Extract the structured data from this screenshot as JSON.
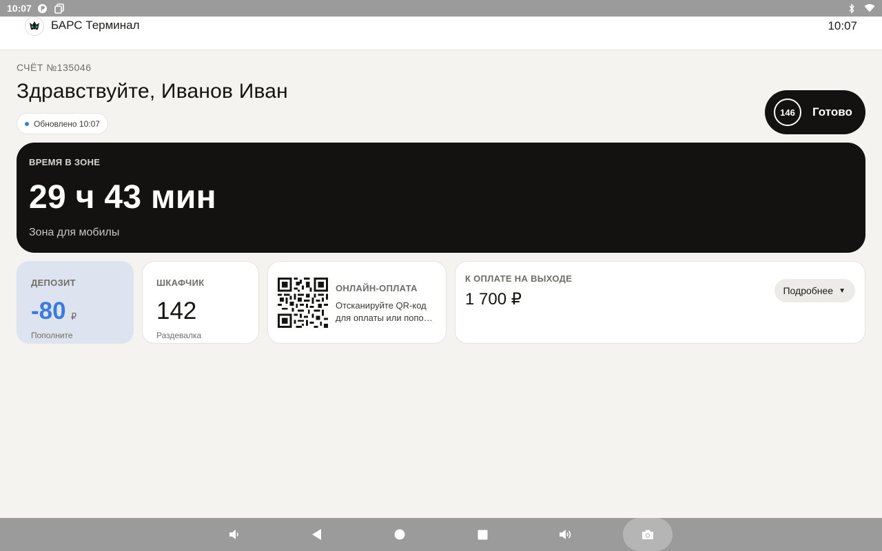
{
  "status_bar": {
    "time": "10:07"
  },
  "header": {
    "app_title": "БАРС Терминал",
    "clock": "10:07"
  },
  "account": {
    "label": "СЧЁТ №135046"
  },
  "greeting": "Здравствуйте, Иванов Иван",
  "updated": {
    "text": "Обновлено 10:07",
    "dot_color": "#3b7be0"
  },
  "ready_button": {
    "number": "146",
    "label": "Готово"
  },
  "zone": {
    "label": "ВРЕМЯ В ЗОНЕ",
    "time": "29 ч 43 мин",
    "name": "Зона для мобилы"
  },
  "deposit": {
    "label": "ДЕПОЗИТ",
    "amount": "-80",
    "currency": "₽",
    "hint": "Пополните",
    "amount_color": "#3b7be0"
  },
  "locker": {
    "label": "ШКАФЧИК",
    "number": "142",
    "location": "Раздевалка"
  },
  "online_payment": {
    "label": "ОНЛАЙН-ОПЛАТА",
    "line1": "Отсканируйте QR-код",
    "line2": "для оплаты или попо…"
  },
  "exit_payment": {
    "label": "К ОПЛАТЕ НА ВЫХОДЕ",
    "amount": "1 700 ₽",
    "details_label": "Подробнее"
  },
  "nav_bar": {
    "buttons": [
      "volume-down-icon",
      "back-icon",
      "home-icon",
      "recents-icon",
      "volume-up-icon",
      "camera-icon"
    ]
  }
}
